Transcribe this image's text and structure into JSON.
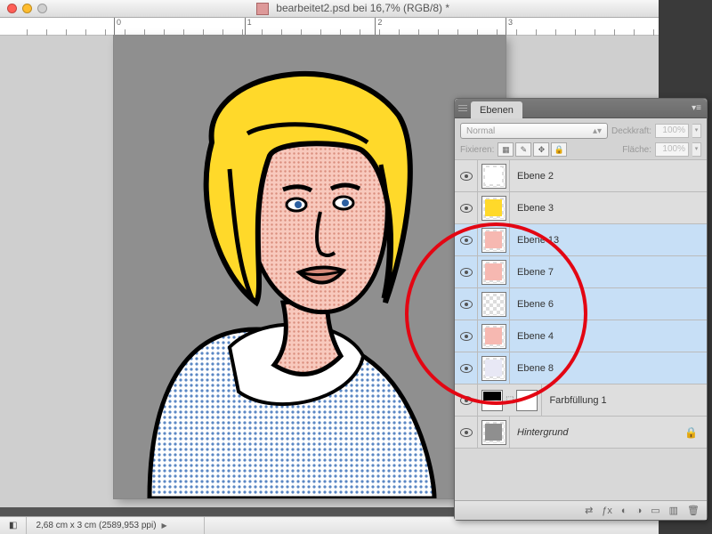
{
  "title": "bearbeitet2.psd bei 16,7% (RGB/8) *",
  "ruler_majors": [
    0,
    1,
    2,
    3
  ],
  "status": {
    "zoom_icon": "◧",
    "dims": "2,68 cm x 3 cm (2589,953 ppi)"
  },
  "panel": {
    "tab": "Ebenen",
    "blend_mode": "Normal",
    "opacity_label": "Deckkraft:",
    "opacity_value": "100%",
    "lock_label": "Fixieren:",
    "fill_label": "Fläche:",
    "fill_value": "100%"
  },
  "layers": [
    {
      "name": "Ebene 2",
      "selected": false,
      "italic": false,
      "thumb_color": "#ffffff"
    },
    {
      "name": "Ebene 3",
      "selected": false,
      "italic": false,
      "thumb_color": "#ffd92a"
    },
    {
      "name": "Ebene 13",
      "selected": true,
      "italic": false,
      "thumb_color": "#f6b8b1"
    },
    {
      "name": "Ebene 7",
      "selected": true,
      "italic": false,
      "thumb_color": "#f6b8b1"
    },
    {
      "name": "Ebene 6",
      "selected": true,
      "italic": false,
      "thumb_color": "transparent"
    },
    {
      "name": "Ebene 4",
      "selected": true,
      "italic": false,
      "thumb_color": "#f6b8b1"
    },
    {
      "name": "Ebene 8",
      "selected": true,
      "italic": false,
      "thumb_color": "#e8e8f5"
    },
    {
      "name": "Farbfüllung 1",
      "selected": false,
      "italic": false,
      "fill_layer": true
    },
    {
      "name": "Hintergrund",
      "selected": false,
      "italic": true,
      "locked": true,
      "thumb_color": "#8f8f8f"
    }
  ],
  "footer_icons": [
    "link-icon",
    "fx-icon",
    "mask-icon",
    "adjust-icon",
    "group-icon",
    "new-layer-icon",
    "trash-icon"
  ],
  "footer_glyphs": [
    "⇄",
    "ƒx",
    "◐",
    "◑",
    "▭",
    "▥",
    "🗑"
  ]
}
